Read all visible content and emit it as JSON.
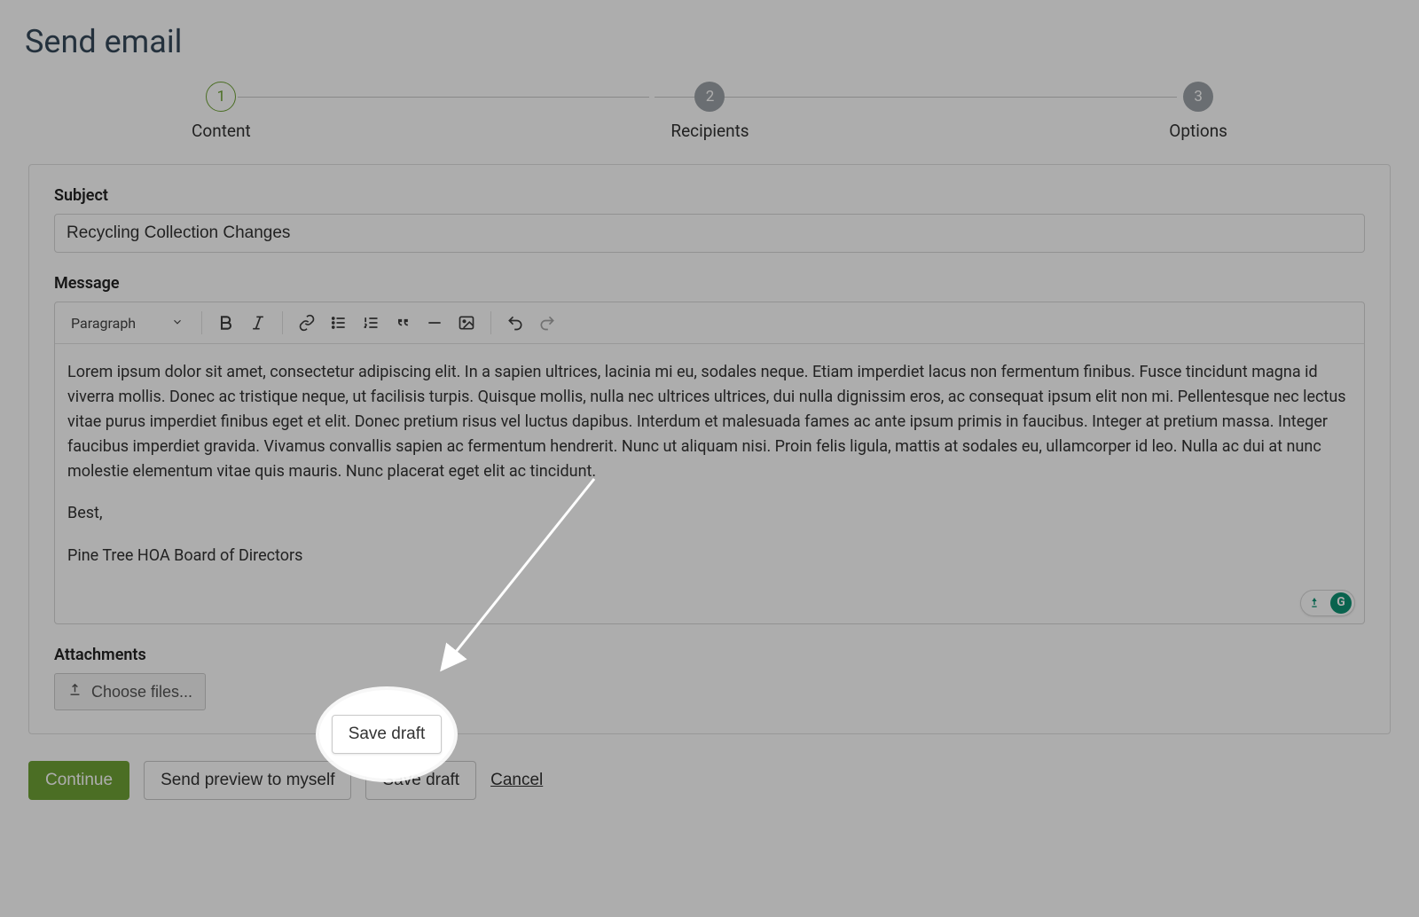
{
  "page_title": "Send email",
  "steps": {
    "content": {
      "num": "1",
      "label": "Content"
    },
    "recipients": {
      "num": "2",
      "label": "Recipients"
    },
    "options": {
      "num": "3",
      "label": "Options"
    }
  },
  "subject": {
    "label": "Subject",
    "value": "Recycling Collection Changes"
  },
  "message": {
    "label": "Message",
    "format_selector": "Paragraph",
    "body_p1": "Lorem ipsum dolor sit amet, consectetur adipiscing elit. In a sapien ultrices, lacinia mi eu, sodales neque. Etiam imperdiet lacus non fermentum finibus. Fusce tincidunt magna id viverra mollis. Donec ac tristique neque, ut facilisis turpis. Quisque mollis, nulla nec ultrices ultrices, dui nulla dignissim eros, ac consequat ipsum elit non mi. Pellentesque nec lectus vitae purus imperdiet finibus eget et elit. Donec pretium risus vel luctus dapibus. Interdum et malesuada fames ac ante ipsum primis in faucibus. Integer at pretium massa. Integer faucibus imperdiet gravida. Vivamus convallis sapien ac fermentum hendrerit. Nunc ut aliquam nisi. Proin felis ligula, mattis at sodales eu, ullamcorper id leo. Nulla ac dui at nunc molestie elementum vitae quis mauris. Nunc placerat eget elit ac tincidunt.",
    "body_p2": "Best,",
    "body_p3": "Pine Tree HOA Board of Directors"
  },
  "attachments": {
    "label": "Attachments",
    "choose_label": "Choose files..."
  },
  "actions": {
    "continue": "Continue",
    "send_preview": "Send preview to myself",
    "save_draft": "Save draft",
    "cancel": "Cancel"
  },
  "grammarly": {
    "g_label": "G"
  }
}
